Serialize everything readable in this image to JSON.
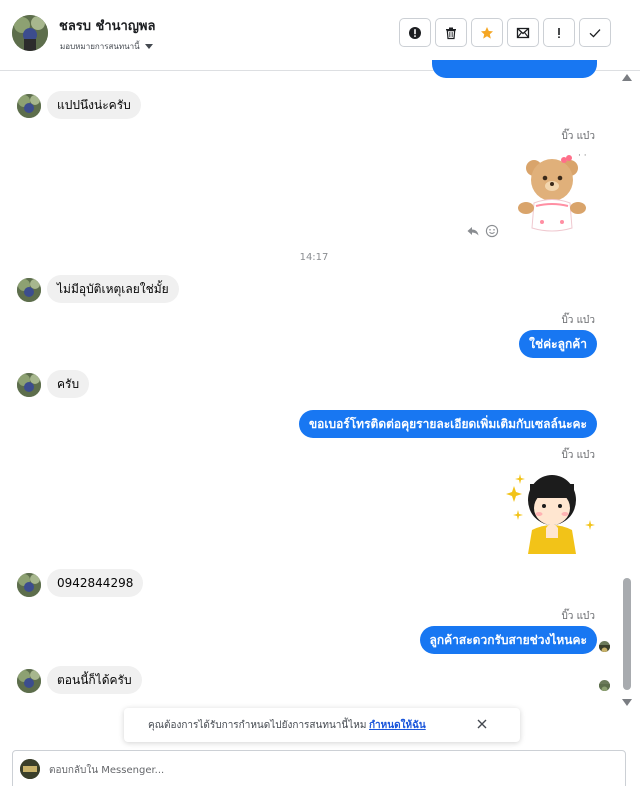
{
  "header": {
    "contact_name": "ชลรบ ชำนาญพล",
    "assign_label": "มอบหมายการสนทนานี้",
    "actions": [
      {
        "name": "alert-circle-icon"
      },
      {
        "name": "trash-icon"
      },
      {
        "name": "star-icon"
      },
      {
        "name": "mark-unread-icon"
      },
      {
        "name": "exclamation-icon"
      },
      {
        "name": "check-icon"
      }
    ]
  },
  "page_sender": "บิ๊ว แบ๋ว",
  "messages": {
    "prev_out_partial": "",
    "m1_in": "แปปนึงน่ะครับ",
    "time_1": "14:17",
    "m2_in": "ไม่มีอุบัติเหตุเลยใช่มั้ย",
    "m3_out": "ใช่ค่ะลูกค้า",
    "m4_in": "ครับ",
    "m5_out": "ขอเบอร์โทรติดต่อคุยรายละเอียดเพิ่มเติมกับเซลล์นะคะ",
    "m6_in": "0942844298",
    "m7_out": "ลูกค้าสะดวกรับสายช่วงไหนคะ",
    "m8_in": "ตอนนี้ก็ได้ครับ"
  },
  "stickers": {
    "bear": "bear-sticker",
    "girl": "girl-sticker"
  },
  "notice": {
    "text": "คุณต้องการได้รับการกำหนดไปยังการสนทนานี้ไหม",
    "link": "กำหนดให้ฉัน"
  },
  "reply": {
    "placeholder": "ตอบกลับใน Messenger..."
  },
  "colors": {
    "outgoing_bubble": "#1877f2",
    "incoming_bubble": "#f0f0f0",
    "star": "#f5a623",
    "link": "#1a56db"
  }
}
